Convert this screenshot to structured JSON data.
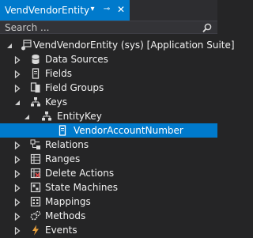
{
  "tab": {
    "title": "VendVendorEntity",
    "menu_glyph": "▾",
    "pin_glyph": "⊸",
    "close_glyph": "✕"
  },
  "search": {
    "placeholder": "Search ..."
  },
  "tree": {
    "root": {
      "label": "VendVendorEntity (sys) [Application Suite]",
      "icon": "table-icon"
    },
    "items": [
      {
        "key": "data-sources",
        "label": "Data Sources",
        "icon": "database-icon"
      },
      {
        "key": "fields",
        "label": "Fields",
        "icon": "field-icon"
      },
      {
        "key": "field-groups",
        "label": "Field Groups",
        "icon": "field-group-icon"
      },
      {
        "key": "keys",
        "label": "Keys",
        "icon": "key-hierarchy-icon",
        "expanded": true
      },
      {
        "key": "entity-key",
        "label": "EntityKey",
        "icon": "key-hierarchy-icon",
        "expanded": true
      },
      {
        "key": "vendor-account-number",
        "label": "VendorAccountNumber",
        "icon": "field-icon",
        "selected": true
      },
      {
        "key": "relations",
        "label": "Relations",
        "icon": "relations-icon"
      },
      {
        "key": "ranges",
        "label": "Ranges",
        "icon": "ranges-icon"
      },
      {
        "key": "delete-actions",
        "label": "Delete Actions",
        "icon": "delete-actions-icon"
      },
      {
        "key": "state-machines",
        "label": "State Machines",
        "icon": "state-machine-icon"
      },
      {
        "key": "mappings",
        "label": "Mappings",
        "icon": "mappings-icon"
      },
      {
        "key": "methods",
        "label": "Methods",
        "icon": "methods-icon"
      },
      {
        "key": "events",
        "label": "Events",
        "icon": "events-icon"
      }
    ]
  },
  "colors": {
    "accent": "#007acc",
    "background": "#252526",
    "text": "#f1f1f1"
  }
}
